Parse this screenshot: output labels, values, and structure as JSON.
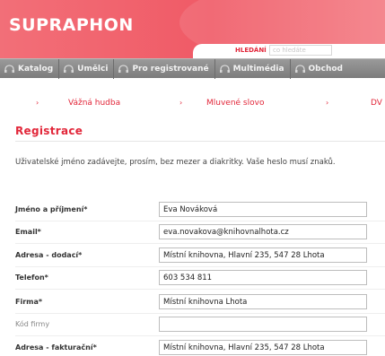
{
  "header": {
    "logo": "SUPRAPHON",
    "search_label": "HLEDÁNÍ",
    "search_placeholder": "co hledáte"
  },
  "nav": {
    "items": [
      {
        "label": "Katalog",
        "icon": "headphones-icon"
      },
      {
        "label": "Umělci",
        "icon": "headphones-icon"
      },
      {
        "label": "Pro registrované",
        "icon": "headphones-icon"
      },
      {
        "label": "Multimédia",
        "icon": "headphones-icon"
      },
      {
        "label": "Obchod",
        "icon": "headphones-icon"
      }
    ]
  },
  "subnav": {
    "items": [
      "Vážná hudba",
      "Mluvené slovo",
      "DV"
    ]
  },
  "page": {
    "title": "Registrace",
    "intro": "Uživatelské jméno zadávejte, prosím, bez mezer a diakritky. Vaše heslo musí znaků."
  },
  "form": {
    "fields": [
      {
        "label": "Jméno a příjmení*",
        "value": "Eva Nováková"
      },
      {
        "label": "Email*",
        "value": "eva.novakova@knihovnalhota.cz"
      },
      {
        "label": "Adresa - dodací*",
        "value": "Místní knihovna, Hlavní 235, 547 28 Lhota"
      },
      {
        "label": "Telefon*",
        "value": "603 534 811"
      },
      {
        "label": "Firma*",
        "value": "Místní knihovna Lhota"
      },
      {
        "label": "Kód firmy",
        "value": ""
      },
      {
        "label": "Adresa - fakturační*",
        "value": "Místní knihovna, Hlavní 235, 547 28 Lhota"
      }
    ]
  },
  "colors": {
    "brand": "#f05a66",
    "accent_red": "#e2273a",
    "nav_gray": "#8a8a8a"
  }
}
